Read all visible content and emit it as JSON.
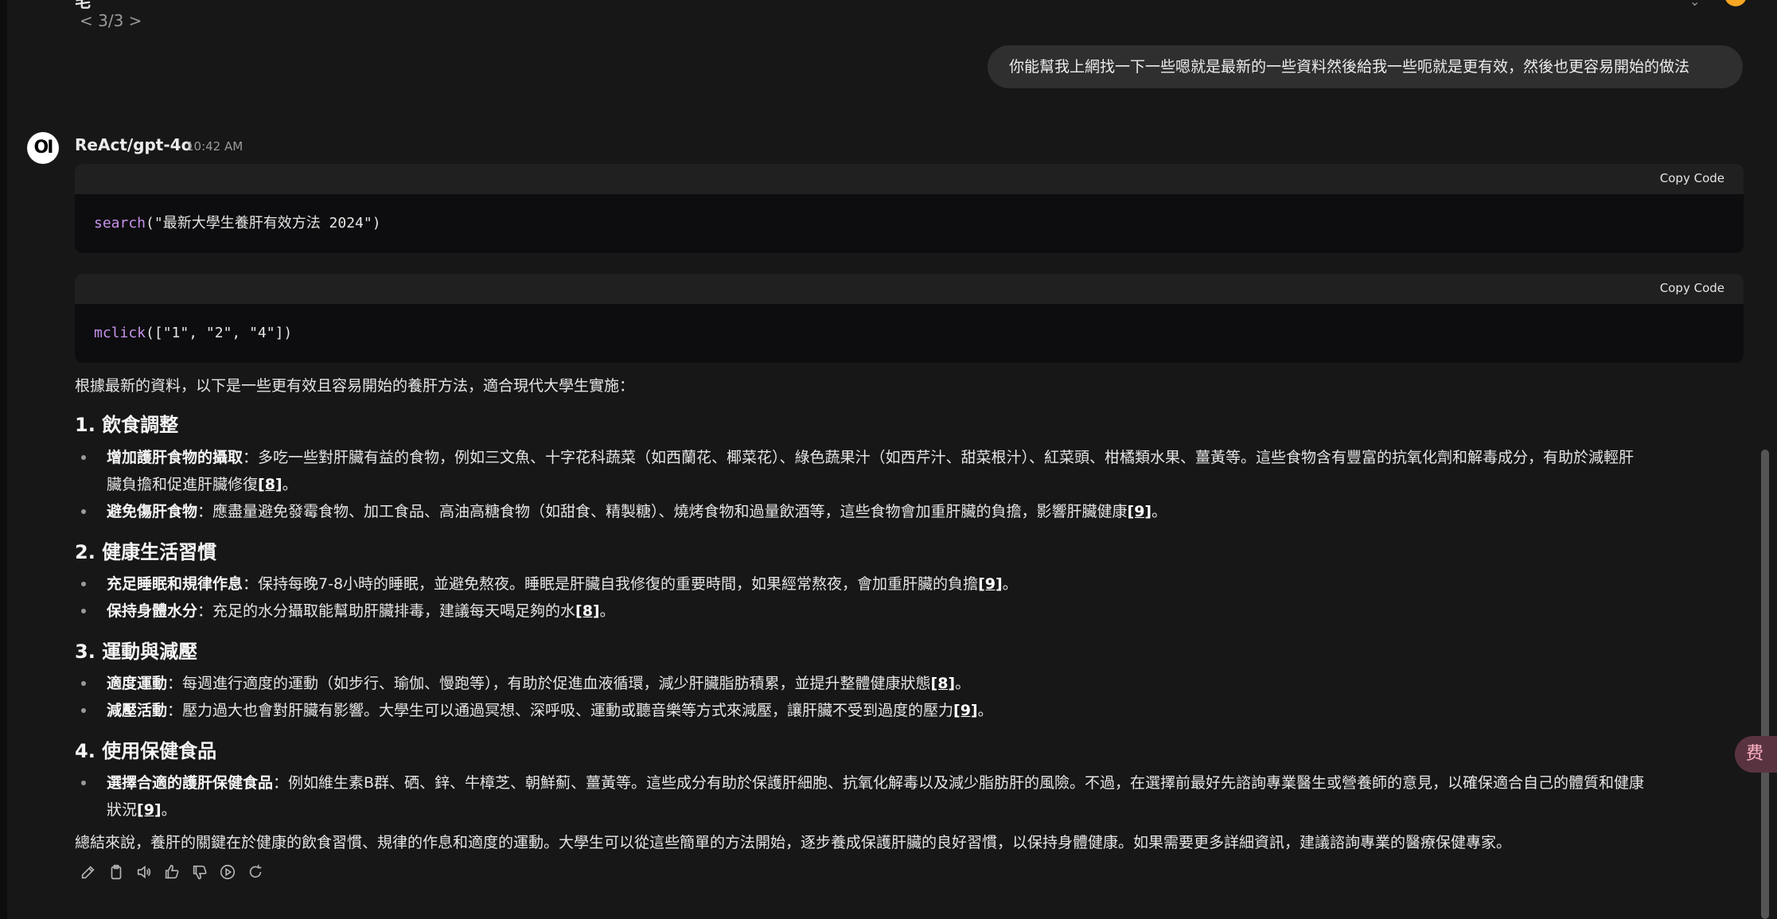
{
  "top_fragment": {
    "title_partial": "毛",
    "pager_partial": "< 3/3 >"
  },
  "user_message": "你能幫我上網找一下一些嗯就是最新的一些資料然後給我一些呃就是更有效，然後也更容易開始的做法",
  "assistant": {
    "avatar_text": "OI",
    "name": "ReAct/gpt-4o",
    "time": "10:42 AM"
  },
  "code_blocks": [
    {
      "copy_label": "Copy Code",
      "fn": "search",
      "args": "(\"最新大學生養肝有效方法 2024\")"
    },
    {
      "copy_label": "Copy Code",
      "fn": "mclick",
      "args": "([\"1\", \"2\", \"4\"])"
    }
  ],
  "content": {
    "intro": "根據最新的資料，以下是一些更有效且容易開始的養肝方法，適合現代大學生實施：",
    "sections": [
      {
        "heading": "1. 飲食調整",
        "items": [
          {
            "title": "增加護肝食物的攝取",
            "text_a": "：多吃一些對肝臟有益的食物，例如三文魚、十字花科蔬菜（如西蘭花、椰菜花）、綠色蔬果汁（如西芹汁、甜菜根汁）、紅菜頭、柑橘類水果、薑黃等。這些食物含有豐富的抗氧化劑和解毒成分，有助於減輕肝",
            "text_b": "臟負擔和促進肝臟修復",
            "ref": "[8]",
            "end": "。"
          },
          {
            "title": "避免傷肝食物",
            "text_a": "：應盡量避免發霉食物、加工食品、高油高糖食物（如甜食、精製糖）、燒烤食物和過量飲酒等，這些食物會加重肝臟的負擔，影響肝臟健康",
            "ref": "[9]",
            "end": "。"
          }
        ]
      },
      {
        "heading": "2. 健康生活習慣",
        "items": [
          {
            "title": "充足睡眠和規律作息",
            "text_a": "：保持每晚7-8小時的睡眠，並避免熬夜。睡眠是肝臟自我修復的重要時間，如果經常熬夜，會加重肝臟的負擔",
            "ref": "[9]",
            "end": "。"
          },
          {
            "title": "保持身體水分",
            "text_a": "：充足的水分攝取能幫助肝臟排毒，建議每天喝足夠的水",
            "ref": "[8]",
            "end": "。"
          }
        ]
      },
      {
        "heading": "3. 運動與減壓",
        "items": [
          {
            "title": "適度運動",
            "text_a": "：每週進行適度的運動（如步行、瑜伽、慢跑等），有助於促進血液循環，減少肝臟脂肪積累，並提升整體健康狀態",
            "ref": "[8]",
            "end": "。"
          },
          {
            "title": "減壓活動",
            "text_a": "：壓力過大也會對肝臟有影響。大學生可以通過冥想、深呼吸、運動或聽音樂等方式來減壓，讓肝臟不受到過度的壓力",
            "ref": "[9]",
            "end": "。"
          }
        ]
      },
      {
        "heading": "4. 使用保健食品",
        "items": [
          {
            "title": "選擇合適的護肝保健食品",
            "text_a": "：例如維生素B群、硒、鋅、牛樟芝、朝鮮薊、薑黃等。這些成分有助於保護肝細胞、抗氧化解毒以及減少脂肪肝的風險。不過，在選擇前最好先諮詢專業醫生或營養師的意見，以確保適合自己的體質和健康",
            "text_b": "狀況",
            "ref": "[9]",
            "end": "。"
          }
        ]
      }
    ],
    "conclusion": "總結來說，養肝的關鍵在於健康的飲食習慣、規律的作息和適度的運動。大學生可以從這些簡單的方法開始，逐步養成保護肝臟的良好習慣，以保持身體健康。如果需要更多詳細資訊，建議諮詢專業的醫療保健專家。"
  },
  "actions": [
    "edit-icon",
    "copy-icon",
    "speaker-icon",
    "thumbs-up-icon",
    "thumbs-down-icon",
    "play-icon",
    "regenerate-icon"
  ],
  "floating_widget": {
    "text": "费"
  }
}
